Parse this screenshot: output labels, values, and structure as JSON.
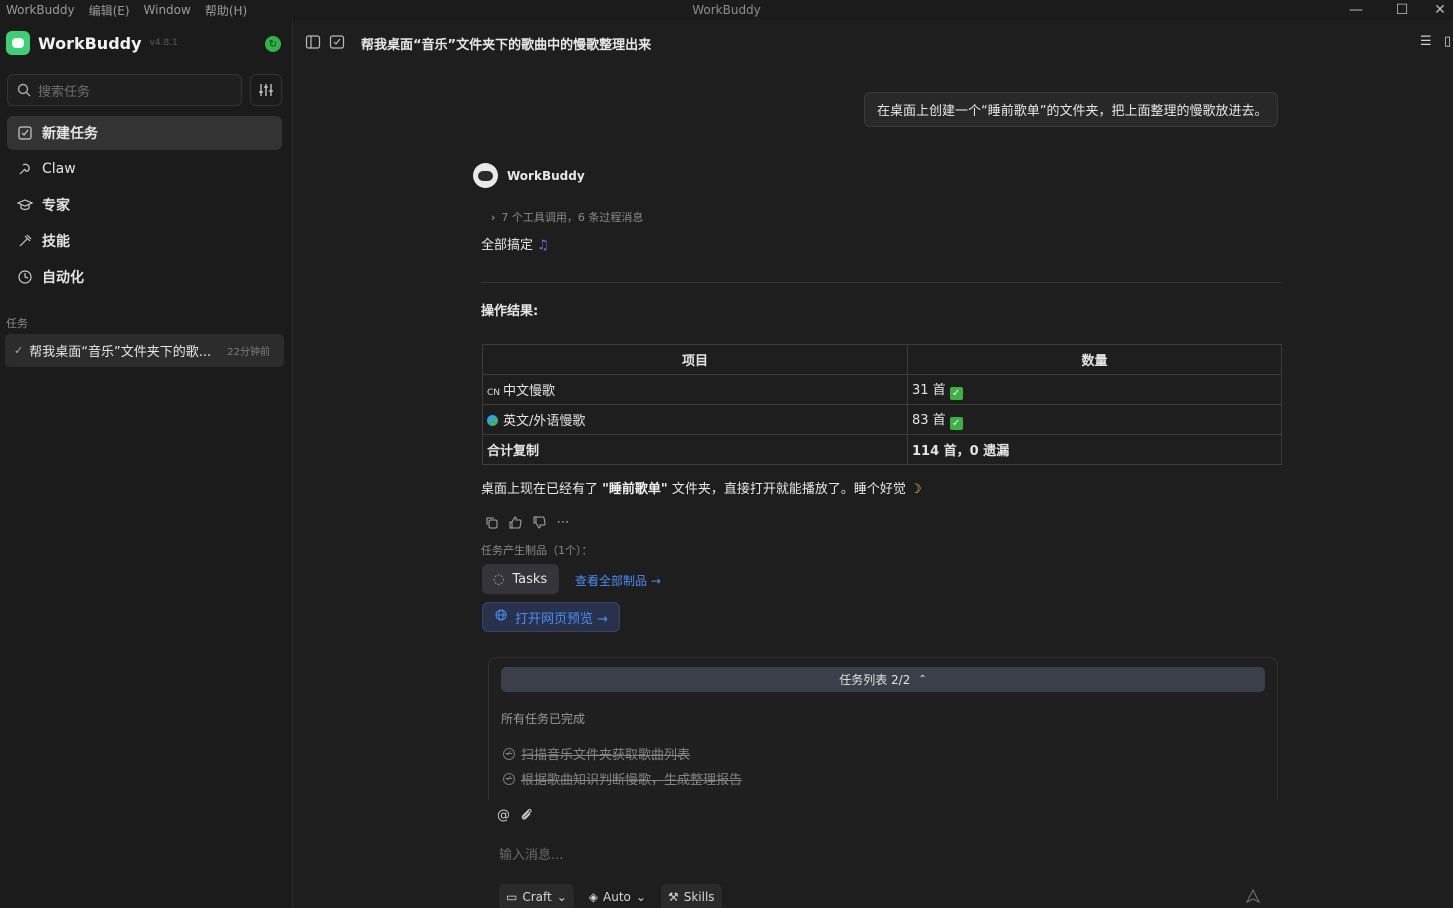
{
  "app": {
    "window_title": "WorkBuddy",
    "menu": [
      "WorkBuddy",
      "编辑(E)",
      "Window",
      "帮助(H)"
    ]
  },
  "sidebar": {
    "brand_name": "WorkBuddy",
    "version": "v4.8.1",
    "search_placeholder": "搜索任务",
    "nav": [
      {
        "label": "新建任务",
        "icon": "edit-square-icon"
      },
      {
        "label": "Claw",
        "icon": "claw-icon"
      },
      {
        "label": "专家",
        "icon": "graduation-cap-icon"
      },
      {
        "label": "技能",
        "icon": "skills-icon"
      },
      {
        "label": "自动化",
        "icon": "clock-icon"
      }
    ],
    "section_label": "任务",
    "tasks": [
      {
        "title": "帮我桌面“音乐”文件夹下的歌...",
        "time": "22分钟前"
      }
    ]
  },
  "conversation": {
    "title": "帮我桌面“音乐”文件夹下的歌曲中的慢歌整理出来",
    "user_message": "在桌面上创建一个“睡前歌单”的文件夹，把上面整理的慢歌放进去。",
    "bot_name": "WorkBuddy",
    "tool_calls": "7 个工具调用，6 条过程消息",
    "done_text": "全部搞定",
    "done_emoji": "♫",
    "result_heading": "操作结果:",
    "table": {
      "headers": [
        "项目",
        "数量"
      ],
      "rows": [
        {
          "prefix": "CN",
          "item": "中文慢歌",
          "count": "31 首"
        },
        {
          "prefix": "",
          "item": "英文/外语慢歌",
          "count": "83 首"
        },
        {
          "prefix": "",
          "item": "合计复制",
          "count": "114 首，0 遗漏"
        }
      ]
    },
    "summary_pre": "桌面上现在已经有了 ",
    "summary_bold": "\"睡前歌单\"",
    "summary_post": " 文件夹，直接打开就能播放了。睡个好觉",
    "summary_emoji": "☽",
    "artifacts_label": "任务产生制品（1个）：",
    "artifact_chip": "Tasks",
    "view_all": "查看全部制品 →",
    "preview_button": "打开网页预览 →"
  },
  "task_list": {
    "header": "任务列表 2/2",
    "status": "所有任务已完成",
    "items": [
      "扫描音乐文件夹获取歌曲列表",
      "根据歌曲知识判断慢歌，生成整理报告"
    ]
  },
  "composer": {
    "placeholder": "输入消息...",
    "mode": "Craft",
    "model": "Auto",
    "skills": "Skills"
  },
  "colors": {
    "accent_blue": "#4a8df6",
    "brand_green": "#3ccf73",
    "check_green": "#3cb043"
  }
}
